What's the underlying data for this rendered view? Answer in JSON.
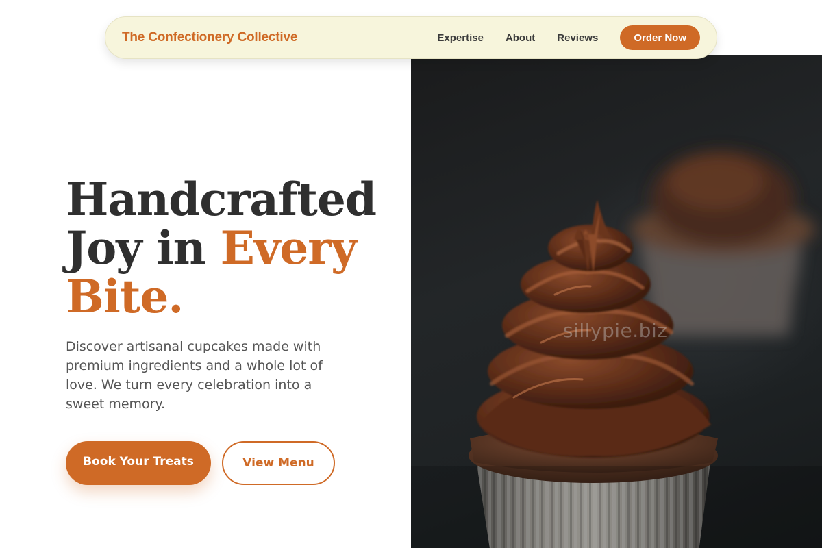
{
  "nav": {
    "brand": "The Confectionery Collective",
    "links": [
      "Expertise",
      "About",
      "Reviews"
    ],
    "order_button": "Order Now"
  },
  "hero": {
    "headline_line1": "Handcrafted",
    "headline_line2_plain": "Joy in ",
    "headline_line2_accent": "Every",
    "headline_line3_accent": "Bite.",
    "subtext": "Discover artisanal cupcakes made with premium ingredients and a whole lot of love. We turn every celebration into a sweet memory.",
    "primary_cta": "Book Your Treats",
    "secondary_cta": "View Menu",
    "image_watermark": "sillypie.biz"
  },
  "colors": {
    "accent": "#cf6a26",
    "nav_background": "#f7f5dc",
    "heading_text": "#2f2f2f",
    "body_text": "#555555"
  }
}
